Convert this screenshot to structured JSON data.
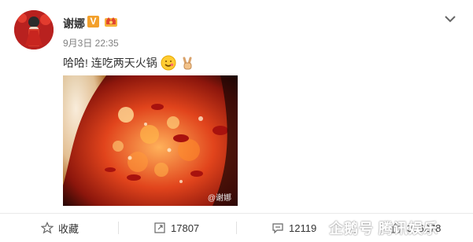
{
  "post": {
    "user": {
      "name": "谢娜"
    },
    "time": "9月3日 22:35",
    "text": "哈哈! 连吃两天火锅",
    "image": {
      "watermark": "@谢娜"
    }
  },
  "actions": {
    "favorite": "收藏",
    "repost_count": "17807",
    "comment_count": "12119",
    "like_count": "356278"
  },
  "overlay": {
    "corner_watermark": "企鹅号 腾讯娱乐"
  },
  "colors": {
    "name": "#333333",
    "time": "#808080",
    "v_badge": "#f3a02b",
    "divider": "#e9e9e9"
  },
  "icons": {
    "verified": "v-badge-icon",
    "member": "crown-badge-icon",
    "menu": "chevron-down-icon",
    "emoji_smile": "smile-emoji-icon",
    "emoji_victory": "victory-hand-emoji-icon",
    "favorite": "star-icon",
    "repost": "repost-icon",
    "comment": "comment-icon",
    "like": "thumbs-up-icon"
  }
}
